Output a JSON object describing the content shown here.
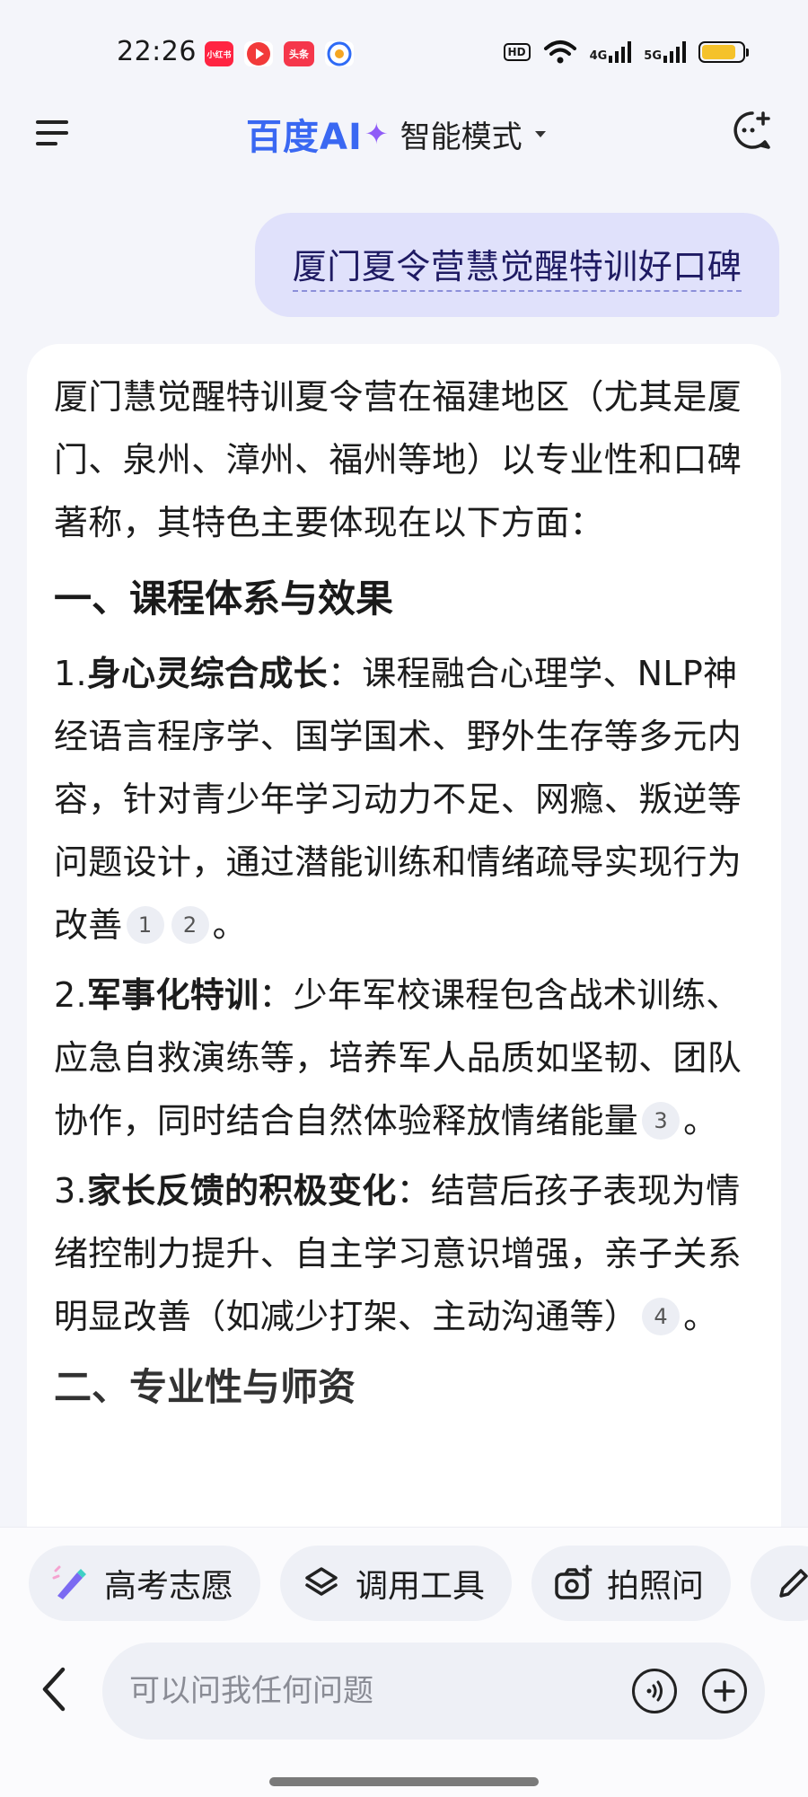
{
  "status": {
    "time": "22:26",
    "notif_xhs": "小红书",
    "notif_toutiao": "头条",
    "hd": "HD",
    "net1": "4G",
    "net2": "5G",
    "battery_level": 0.85
  },
  "header": {
    "brand": "百度AI",
    "mode": "智能模式"
  },
  "user_message": "厦门夏令营慧觉醒特训好口碑",
  "answer": {
    "intro": "厦门慧觉醒特训夏令营在福建地区（尤其是厦门、泉州、漳州、福州等地）以专业性和口碑著称，其特色主要体现在以下方面：",
    "section1_title": "一、课程体系与效果",
    "items": [
      {
        "num": "1.",
        "bold": "身心灵综合成长",
        "text": "：课程融合心理学、NLP神经语言程序学、国学国术、野外生存等多元内容，针对青少年学习动力不足、网瘾、叛逆等问题设计，通过潜能训练和情绪疏导实现行为改善",
        "cites": [
          "1",
          "2"
        ],
        "end": "。"
      },
      {
        "num": "2.",
        "bold": "军事化特训",
        "text": "：少年军校课程包含战术训练、应急自救演练等，培养军人品质如坚韧、团队协作，同时结合自然体验释放情绪能量",
        "cites": [
          "3"
        ],
        "end": "。"
      },
      {
        "num": "3.",
        "bold": "家长反馈的积极变化",
        "text": "：结营后孩子表现为情绪控制力提升、自主学习意识增强，亲子关系明显改善（如减少打架、主动沟通等）",
        "cites": [
          "4"
        ],
        "end": "。"
      }
    ],
    "section2_title": "二、专业性与师资"
  },
  "chips": [
    {
      "label": "高考志愿",
      "icon": "gaokao-pen-icon"
    },
    {
      "label": "调用工具",
      "icon": "layers-icon"
    },
    {
      "label": "拍照问",
      "icon": "camera-icon"
    }
  ],
  "input": {
    "placeholder": "可以问我任何问题"
  }
}
